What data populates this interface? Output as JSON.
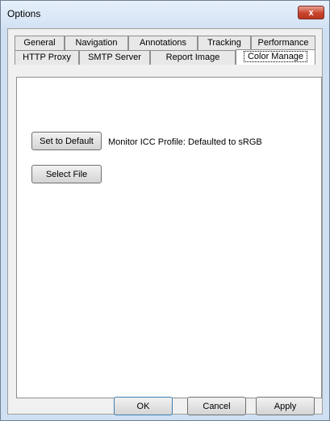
{
  "window": {
    "title": "Options",
    "close_glyph": "x"
  },
  "tabs_row1": [
    "General",
    "Navigation",
    "Annotations",
    "Tracking",
    "Performance"
  ],
  "tabs_row2": [
    "HTTP Proxy",
    "SMTP Server",
    "Report Image",
    "Color Manage"
  ],
  "active_tab": "Color Manage",
  "panel": {
    "set_default_label": "Set to Default",
    "monitor_profile_text": "Monitor ICC Profile: Defaulted to sRGB",
    "select_file_label": "Select File"
  },
  "footer": {
    "ok_label": "OK",
    "cancel_label": "Cancel",
    "apply_label": "Apply"
  }
}
